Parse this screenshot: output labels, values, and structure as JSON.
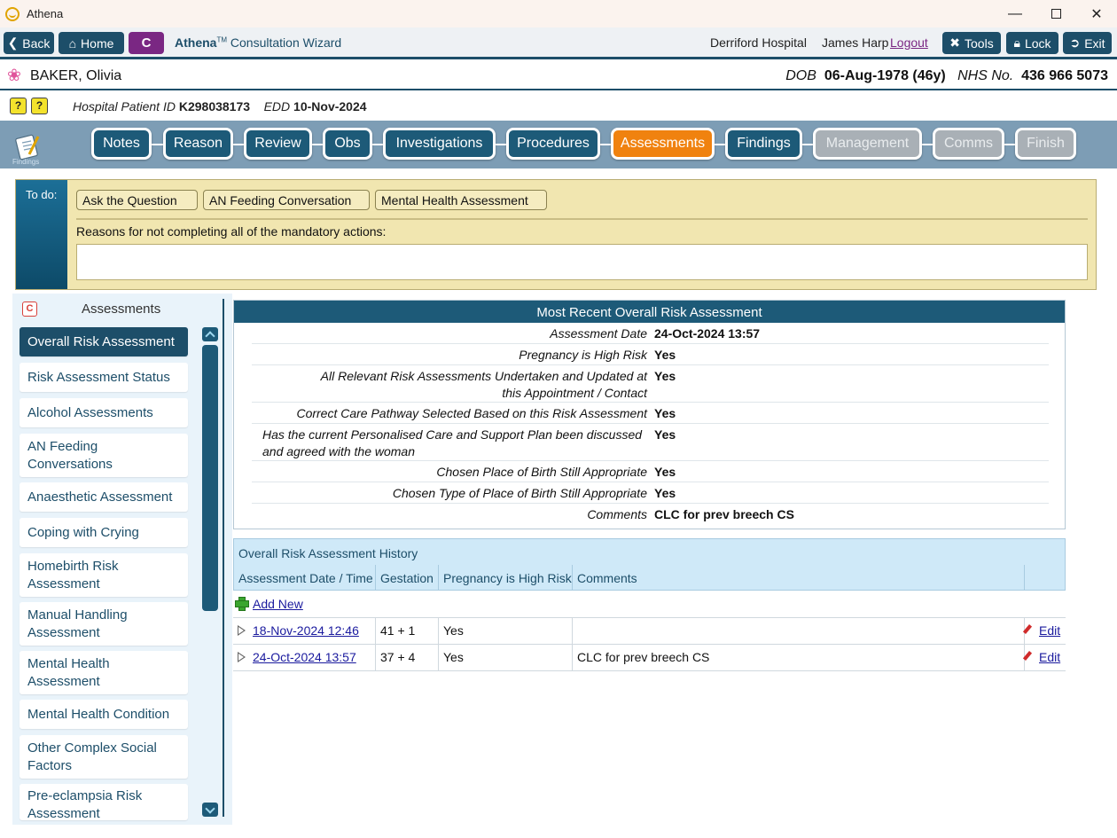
{
  "window": {
    "title": "Athena"
  },
  "toolbar": {
    "back": "Back",
    "home": "Home",
    "c_label": "C",
    "wizard_brand": "Athena",
    "wizard_tm": "TM",
    "wizard_title": "Consultation Wizard",
    "hospital": "Derriford Hospital",
    "user": "James Harp",
    "logout": "Logout",
    "tools": "Tools",
    "lock": "Lock",
    "exit": "Exit"
  },
  "patient": {
    "name": "BAKER, Olivia",
    "dob_label": "DOB",
    "dob_value": "06-Aug-1978 (46y)",
    "nhs_label": "NHS No.",
    "nhs_value": "436 966 5073",
    "hospital_id_label": "Hospital Patient ID",
    "hospital_id": "K298038173",
    "edd_label": "EDD",
    "edd": "10-Nov-2024"
  },
  "wizard": {
    "icon_label": "Findings",
    "tabs": [
      {
        "label": "Notes",
        "state": "normal"
      },
      {
        "label": "Reason",
        "state": "normal"
      },
      {
        "label": "Review",
        "state": "normal"
      },
      {
        "label": "Obs",
        "state": "normal"
      },
      {
        "label": "Investigations",
        "state": "normal"
      },
      {
        "label": "Procedures",
        "state": "normal"
      },
      {
        "label": "Assessments",
        "state": "active"
      },
      {
        "label": "Findings",
        "state": "normal"
      },
      {
        "label": "Management",
        "state": "disabled"
      },
      {
        "label": "Comms",
        "state": "disabled"
      },
      {
        "label": "Finish",
        "state": "disabled"
      }
    ]
  },
  "todo": {
    "label": "To do:",
    "actions": [
      "Ask the Question",
      "AN Feeding Conversation",
      "Mental Health Assessment"
    ],
    "reason_label": "Reasons for not completing all of the mandatory actions:",
    "reason_value": ""
  },
  "nav": {
    "header": "Assessments",
    "header_icon": "C",
    "items": [
      "Overall Risk Assessment",
      "Risk Assessment Status",
      "Alcohol Assessments",
      "AN Feeding Conversations",
      "Anaesthetic Assessment",
      "Coping with Crying",
      "Homebirth Risk Assessment",
      "Manual Handling Assessment",
      "Mental Health Assessment",
      "Mental Health Condition",
      "Other Complex Social Factors",
      "Pre-eclampsia Risk Assessment"
    ]
  },
  "most_recent": {
    "title": "Most Recent Overall Risk Assessment",
    "rows": [
      {
        "label": "Assessment Date",
        "value": "24-Oct-2024 13:57"
      },
      {
        "label": "Pregnancy is High Risk",
        "value": "Yes"
      },
      {
        "label": "All Relevant Risk Assessments Undertaken and Updated at this Appointment / Contact",
        "value": "Yes"
      },
      {
        "label": "Correct Care Pathway Selected Based on this Risk Assessment",
        "value": "Yes"
      },
      {
        "label": "Has the current Personalised Care and Support Plan been discussed and agreed with the woman",
        "value": "Yes"
      },
      {
        "label": "Chosen Place of Birth Still Appropriate",
        "value": "Yes"
      },
      {
        "label": "Chosen Type of Place of Birth Still Appropriate",
        "value": "Yes"
      },
      {
        "label": "Comments",
        "value": "CLC for prev breech CS"
      }
    ]
  },
  "history": {
    "title": "Overall Risk Assessment History",
    "columns": [
      "Assessment Date / Time",
      "Gestation",
      "Pregnancy is High Risk",
      "Comments"
    ],
    "add_new": "Add New",
    "rows": [
      {
        "date": "18-Nov-2024 12:46",
        "gestation": "41 + 1",
        "high_risk": "Yes",
        "comments": "",
        "edit": "Edit"
      },
      {
        "date": "24-Oct-2024 13:57",
        "gestation": "37 + 4",
        "high_risk": "Yes",
        "comments": "CLC for prev breech CS",
        "edit": "Edit"
      }
    ]
  },
  "colors": {
    "primary": "#1d4e69",
    "active_tab": "#f0820f",
    "disabled_tab": "#a9b0b6",
    "todo_bg": "#f1e6b0",
    "c_button": "#7a2783"
  }
}
